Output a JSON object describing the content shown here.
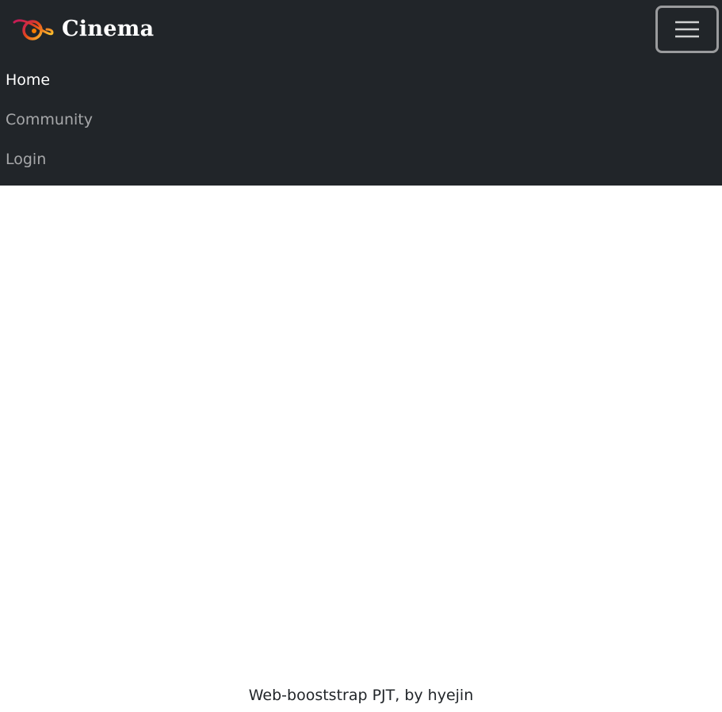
{
  "brand": {
    "name": "Cinema",
    "logo_icon": "planet-icon"
  },
  "nav": {
    "toggler_icon": "hamburger-menu-icon",
    "items": [
      {
        "label": "Home",
        "active": true
      },
      {
        "label": "Community",
        "active": false
      },
      {
        "label": "Login",
        "active": false
      }
    ]
  },
  "footer": {
    "text": "Web-booststrap PJT, by hyejin"
  },
  "colors": {
    "navbar_bg": "#212529",
    "logo_gradient_start": "#c2185b",
    "logo_gradient_end": "#fbc02d",
    "toggler_border": "#9a9b9d"
  }
}
